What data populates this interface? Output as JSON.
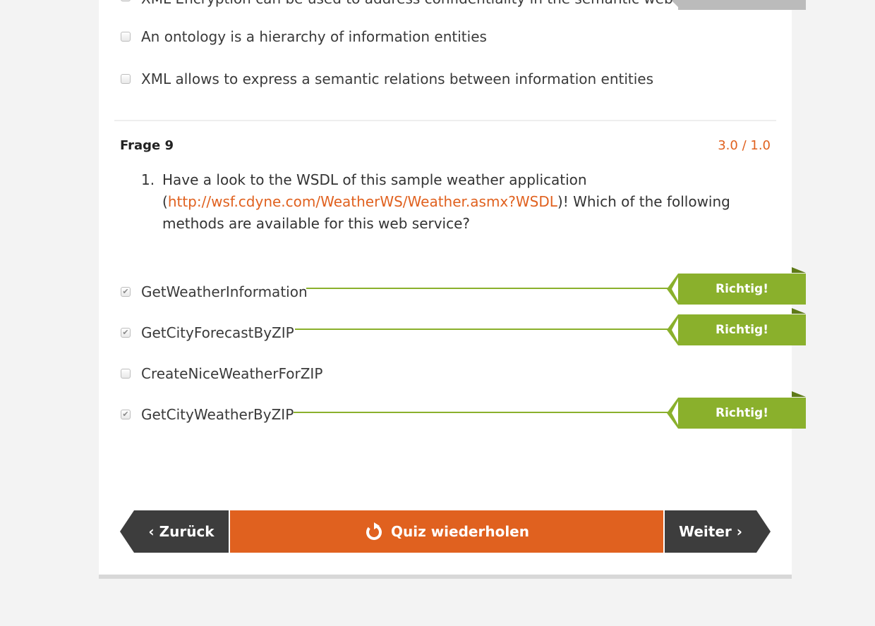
{
  "prev_question": {
    "options": [
      {
        "label": "XML Encryption can be used to address confidentiality in the semantic web",
        "checked": false
      },
      {
        "label": "An ontology is a hierarchy of information entities",
        "checked": false
      },
      {
        "label": "XML allows to express a semantic relations between information entities",
        "checked": false
      }
    ]
  },
  "question": {
    "title": "Frage 9",
    "score": "3.0 / 1.0",
    "number": "1.",
    "text_before": "Have a look to the WSDL of this sample weather application (",
    "link": "http://wsf.cdyne.com/WeatherWS/Weather.asmx?WSDL",
    "text_after": ")! Which of the following methods are available for this web service?",
    "options": [
      {
        "label": "GetWeatherInformation",
        "checked": true,
        "feedback": "Richtig!"
      },
      {
        "label": "GetCityForecastByZIP",
        "checked": true,
        "feedback": "Richtig!"
      },
      {
        "label": "CreateNiceWeatherForZIP",
        "checked": false,
        "feedback": ""
      },
      {
        "label": "GetCityWeatherByZIP",
        "checked": true,
        "feedback": "Richtig!"
      }
    ]
  },
  "nav": {
    "back_chevron": "‹",
    "back_label": "Zurück",
    "retry_label": "Quiz wiederholen",
    "retry_icon": "refresh-icon",
    "next_label": "Weiter",
    "next_chevron": "›"
  },
  "colors": {
    "accent": "#e0611f",
    "correct": "#8ab02c",
    "dark_button": "#3d3d3d"
  }
}
